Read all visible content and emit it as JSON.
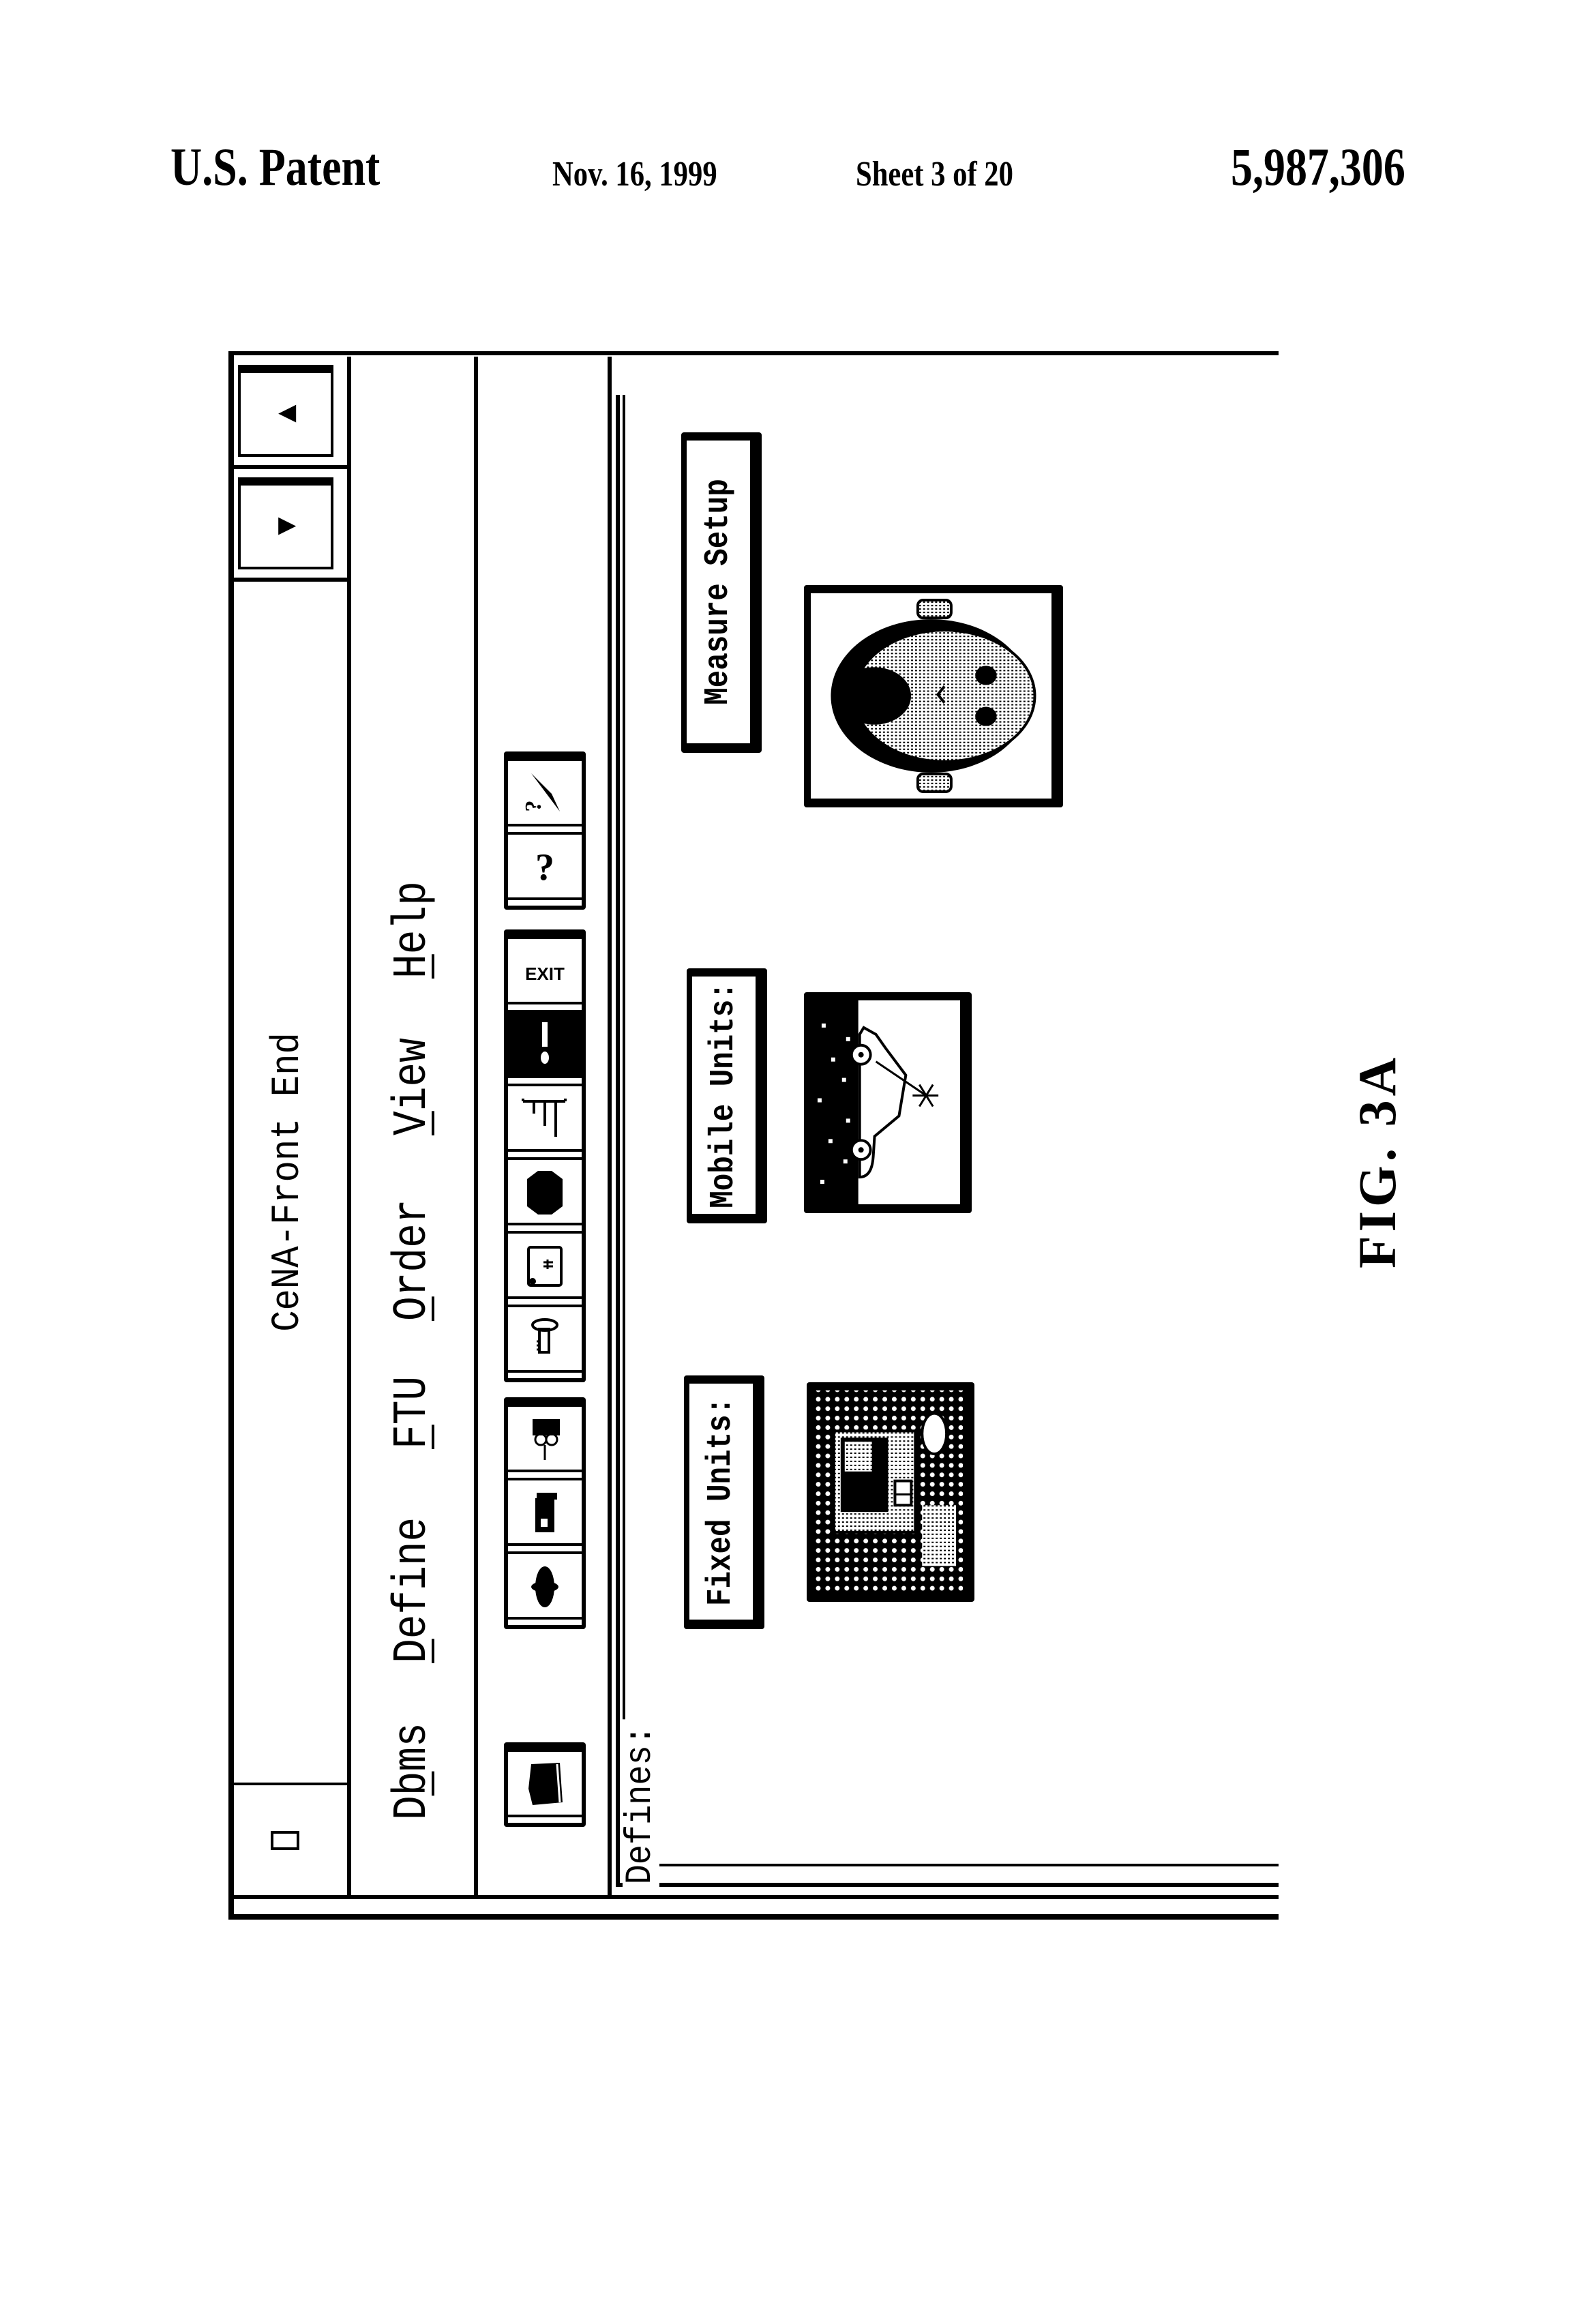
{
  "header": {
    "patent_label": "U.S. Patent",
    "date": "Nov. 16, 1999",
    "sheet": "Sheet 3 of 20",
    "patent_number": "5,987,306"
  },
  "window": {
    "title": "CeNA-Front End",
    "system_menu_icon": "system-menu-icon",
    "buttons": [
      {
        "name": "minimize",
        "glyph": "▼",
        "icon": "down-arrow-icon"
      },
      {
        "name": "maximize",
        "glyph": "▲",
        "icon": "up-arrow-icon"
      }
    ]
  },
  "menubar": {
    "items": [
      {
        "label": "Dbms",
        "mnemonic": "b"
      },
      {
        "label": "Define",
        "mnemonic": "D"
      },
      {
        "label": "FTU",
        "mnemonic": "F"
      },
      {
        "label": "Order",
        "mnemonic": "O"
      },
      {
        "label": "View",
        "mnemonic": "V"
      },
      {
        "label": "Help",
        "mnemonic": "H"
      }
    ]
  },
  "toolbar": {
    "groups": [
      {
        "buttons": [
          {
            "icon": "folder-icon"
          }
        ]
      },
      {
        "buttons": [
          {
            "icon": "person-icon"
          },
          {
            "icon": "building-icon"
          },
          {
            "icon": "vehicle-icon"
          }
        ]
      },
      {
        "buttons": [
          {
            "icon": "key-icon"
          },
          {
            "icon": "document-icon"
          },
          {
            "icon": "stop-icon"
          },
          {
            "icon": "bar-chart-icon"
          },
          {
            "icon": "info-icon"
          },
          {
            "icon": "exit-icon",
            "text": "EXIT"
          }
        ]
      },
      {
        "buttons": [
          {
            "icon": "help-icon",
            "text": "?"
          },
          {
            "icon": "context-help-icon",
            "text": "?"
          }
        ]
      }
    ]
  },
  "defines": {
    "label": "Defines:",
    "units": [
      {
        "id": "fixed",
        "button_label": "Fixed Units:",
        "picture": "fixed-unit-building-illustration"
      },
      {
        "id": "mobile",
        "button_label": "Mobile Units:",
        "picture": "mobile-unit-car-illustration"
      },
      {
        "id": "measure",
        "button_label": "Measure Setup",
        "picture": "measure-setup-head-illustration"
      }
    ]
  },
  "figure_label": "FIG. 3A"
}
